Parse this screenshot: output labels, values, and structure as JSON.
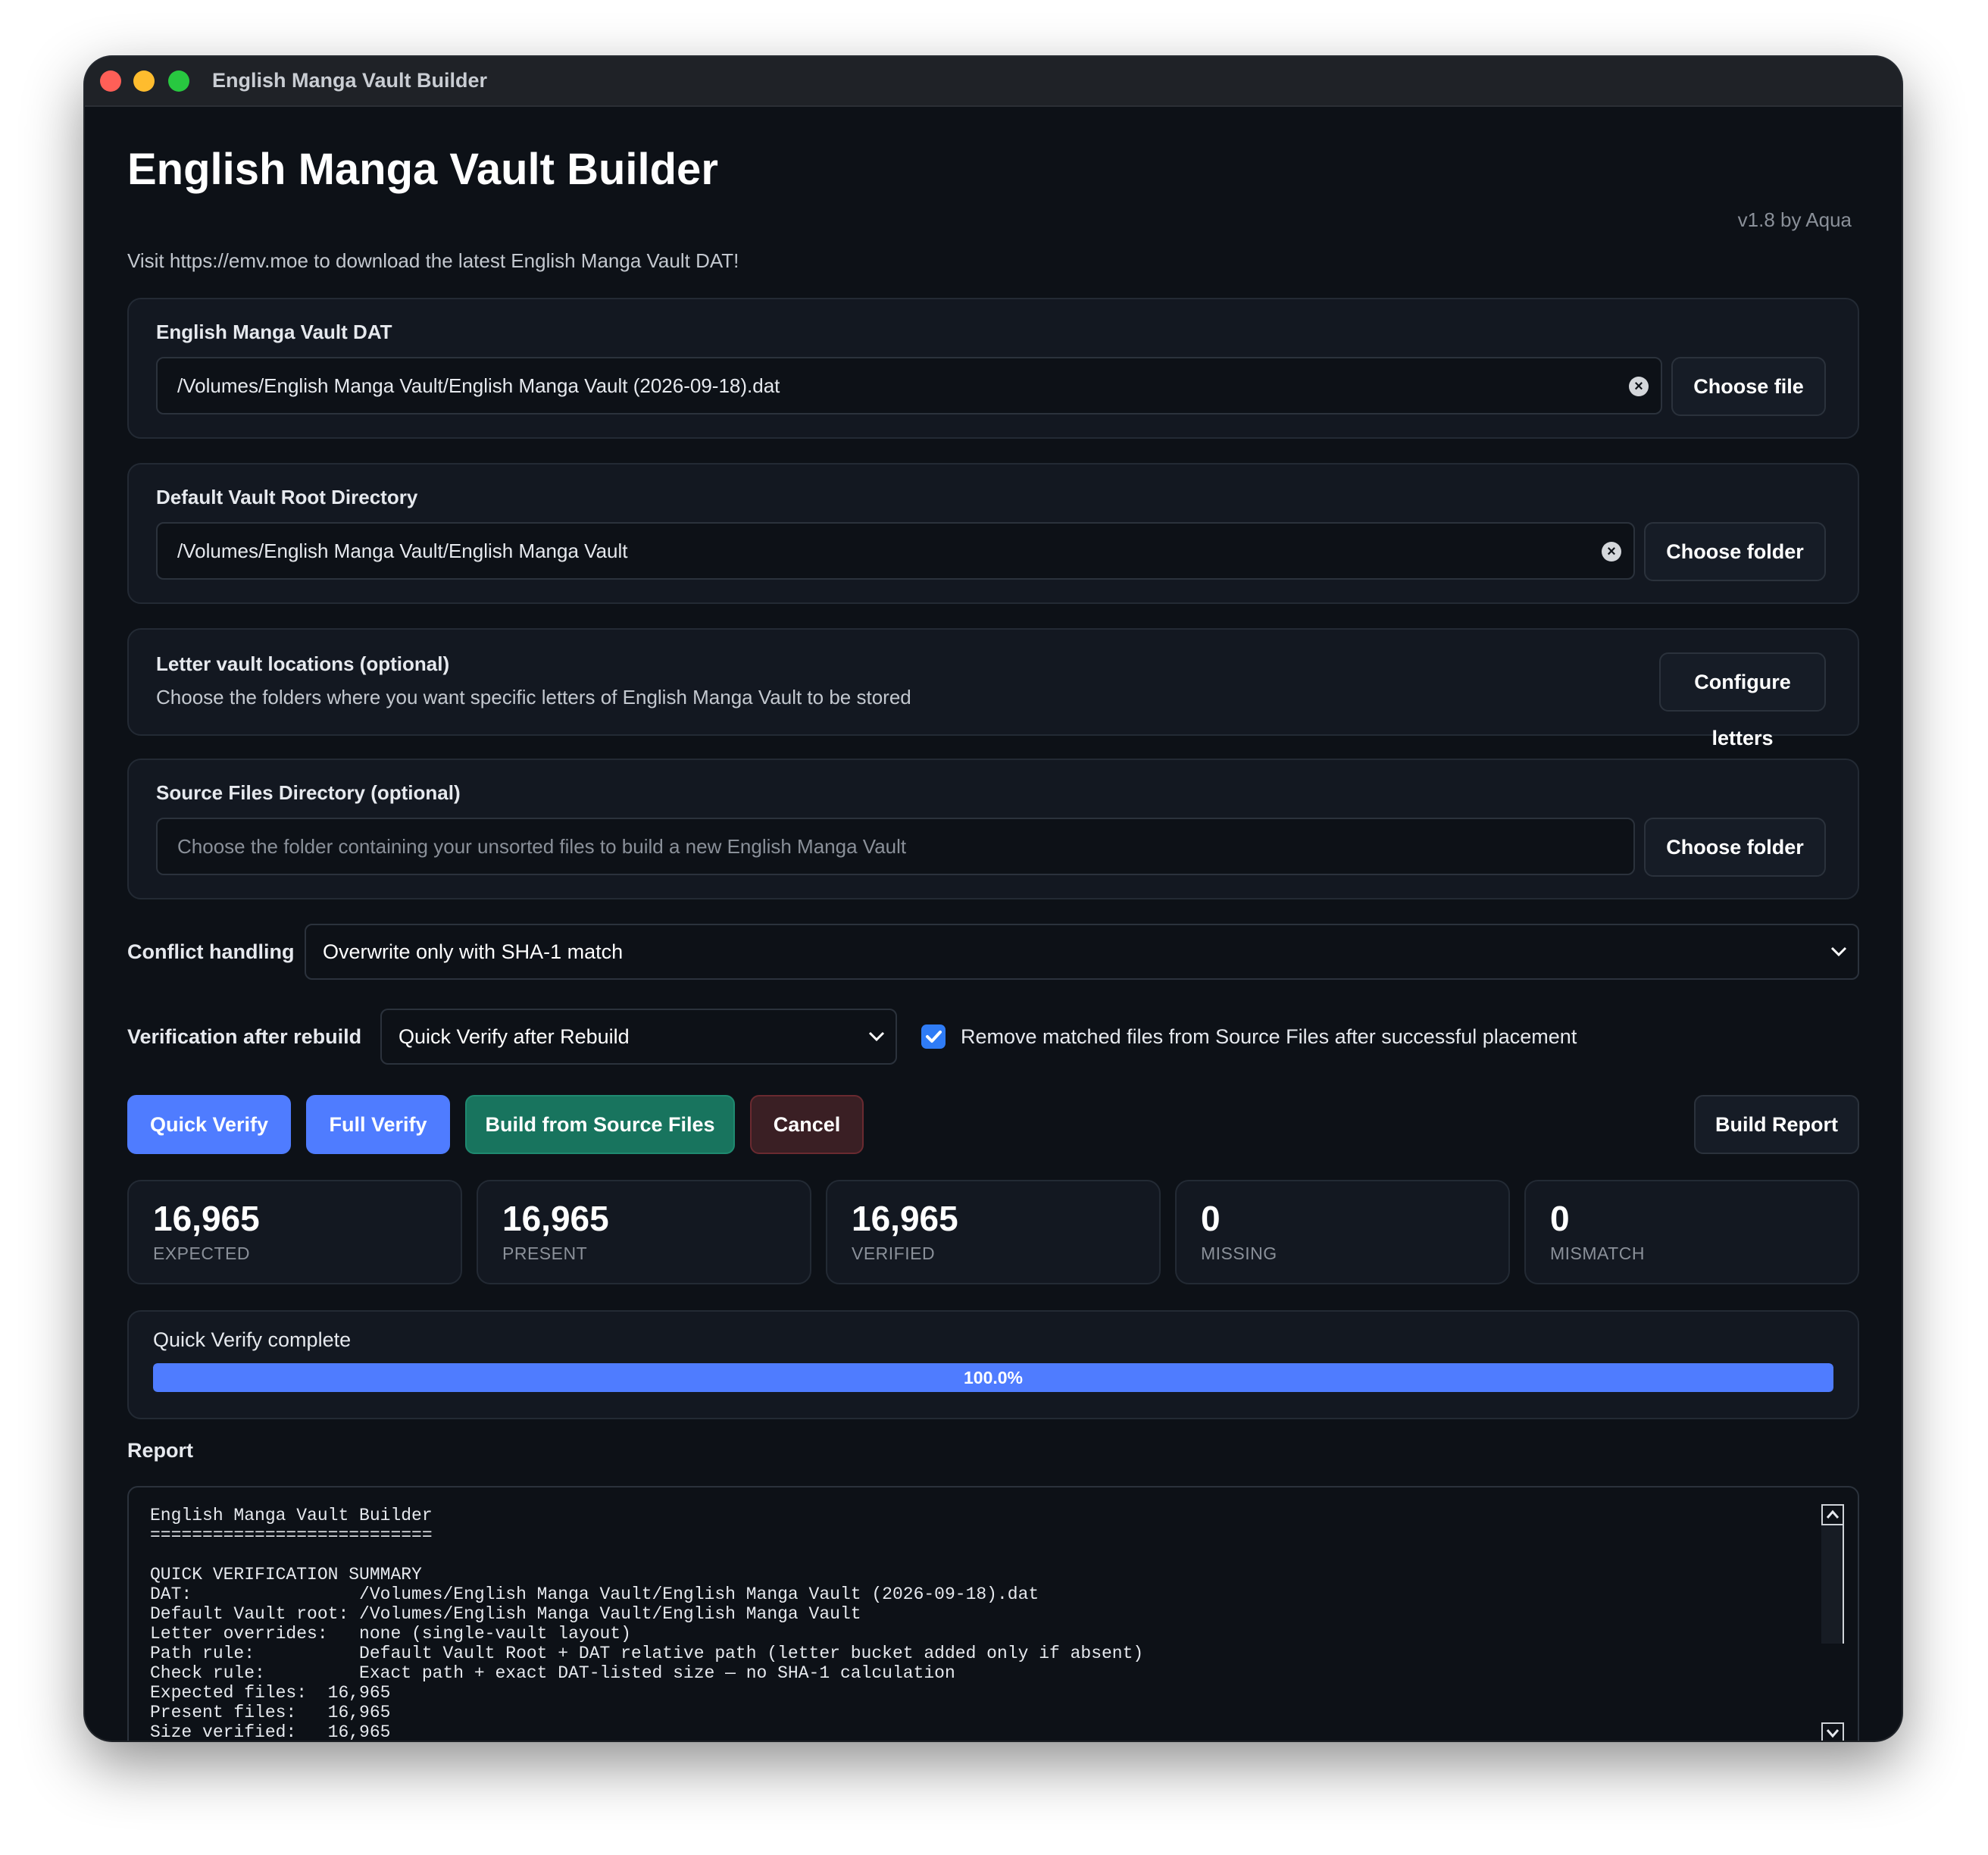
{
  "window": {
    "title": "English Manga Vault Builder"
  },
  "header": {
    "title": "English Manga Vault Builder",
    "subtitle": "Visit https://emv.moe to download the latest English Manga Vault DAT!",
    "version": "v1.8 by Aqua"
  },
  "dat": {
    "label": "English Manga Vault DAT",
    "value": "/Volumes/English Manga Vault/English Manga Vault (2026-09-18).dat",
    "button": "Choose file"
  },
  "root": {
    "label": "Default Vault Root Directory",
    "value": "/Volumes/English Manga Vault/English Manga Vault",
    "button": "Choose folder"
  },
  "letters": {
    "label": "Letter vault locations (optional)",
    "description": "Choose the folders where you want specific letters of English Manga Vault to be stored",
    "button": "Configure letters"
  },
  "source": {
    "label": "Source Files Directory (optional)",
    "placeholder": "Choose the folder containing your unsorted files to build a new English Manga Vault",
    "button": "Choose folder"
  },
  "conflict": {
    "label": "Conflict handling",
    "selected": "Overwrite only with SHA-1 match"
  },
  "verification": {
    "label": "Verification after rebuild",
    "selected": "Quick Verify after Rebuild",
    "remove_checked": true,
    "remove_label": "Remove matched files from Source Files after successful placement"
  },
  "actions": {
    "quick_verify": "Quick Verify",
    "full_verify": "Full Verify",
    "build": "Build from Source Files",
    "cancel": "Cancel",
    "report": "Build Report"
  },
  "stats": [
    {
      "value": "16,965",
      "label": "EXPECTED"
    },
    {
      "value": "16,965",
      "label": "PRESENT"
    },
    {
      "value": "16,965",
      "label": "VERIFIED"
    },
    {
      "value": "0",
      "label": "MISSING"
    },
    {
      "value": "0",
      "label": "MISMATCH"
    }
  ],
  "progress": {
    "status": "Quick Verify complete",
    "fraction": 1.0,
    "text": "100.0%"
  },
  "report": {
    "heading": "Report",
    "lines": [
      "English Manga Vault Builder",
      "===========================",
      "",
      "QUICK VERIFICATION SUMMARY",
      "DAT:                /Volumes/English Manga Vault/English Manga Vault (2026-09-18).dat",
      "Default Vault root: /Volumes/English Manga Vault/English Manga Vault",
      "Letter overrides:   none (single-vault layout)",
      "Path rule:          Default Vault Root + DAT relative path (letter bucket added only if absent)",
      "Check rule:         Exact path + exact DAT-listed size — no SHA-1 calculation",
      "Expected files:  16,965",
      "Present files:   16,965",
      "Size verified:   16,965"
    ]
  },
  "colors": {
    "background": "#0d1117",
    "card": "#131821",
    "accent_blue": "#4f7cff",
    "accent_green": "#18745e",
    "accent_red": "#3a1f24"
  }
}
